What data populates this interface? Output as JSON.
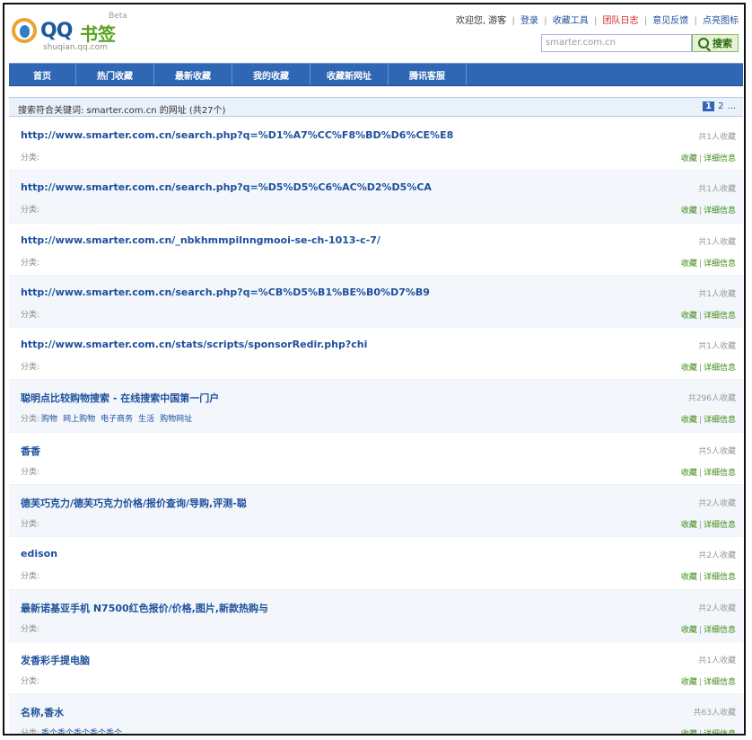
{
  "header": {
    "logo": {
      "qq": "QQ",
      "cn": "书签",
      "beta": "Beta",
      "sub": "shuqian.qq.com"
    },
    "welcome": "欢迎您, 游客",
    "links": [
      {
        "label": "登录",
        "red": false
      },
      {
        "label": "收藏工具",
        "red": false
      },
      {
        "label": "团队日志",
        "red": true
      },
      {
        "label": "意见反馈",
        "red": false
      },
      {
        "label": "点亮图标",
        "red": false
      }
    ],
    "search": {
      "value": "smarter.com.cn",
      "button": "搜索"
    }
  },
  "nav": [
    "首页",
    "热门收藏",
    "最新收藏",
    "我的收藏",
    "收藏新网址",
    "腾讯客服"
  ],
  "results": {
    "summary": "搜索符合关键词: smarter.com.cn 的网址 (共27个)",
    "pages": [
      "1",
      "2",
      "..."
    ]
  },
  "items": [
    {
      "title": "http://www.smarter.com.cn/search.php?q=%D1%A7%CC%F8%BD%D6%CE%E8",
      "count": "共1人收藏",
      "cat": "分类:",
      "tags": []
    },
    {
      "title": "http://www.smarter.com.cn/search.php?q=%D5%D5%C6%AC%D2%D5%CA",
      "count": "共1人收藏",
      "cat": "分类:",
      "tags": []
    },
    {
      "title": "http://www.smarter.com.cn/_nbkhmmpilnngmooi-se-ch-1013-c-7/",
      "count": "共1人收藏",
      "cat": "分类:",
      "tags": []
    },
    {
      "title": "http://www.smarter.com.cn/search.php?q=%CB%D5%B1%BE%B0%D7%B9",
      "count": "共1人收藏",
      "cat": "分类:",
      "tags": []
    },
    {
      "title": "http://www.smarter.com.cn/stats/scripts/sponsorRedir.php?chi",
      "count": "共1人收藏",
      "cat": "分类:",
      "tags": []
    },
    {
      "title": "聪明点比较购物搜索 - 在线搜索中国第一门户",
      "count": "共296人收藏",
      "cat": "分类:",
      "tags": [
        "购物",
        "网上购物",
        "电子商务",
        "生活",
        "购物网址"
      ]
    },
    {
      "title": "香香",
      "count": "共5人收藏",
      "cat": "分类:",
      "tags": []
    },
    {
      "title": "德芙巧克力/德芙巧克力价格/报价查询/导购,评测-聪",
      "count": "共2人收藏",
      "cat": "分类:",
      "tags": []
    },
    {
      "title": "edison",
      "count": "共2人收藏",
      "cat": "分类:",
      "tags": []
    },
    {
      "title": "最新诺基亚手机 N7500红色报价/价格,图片,新款热购与",
      "count": "共2人收藏",
      "cat": "分类:",
      "tags": []
    },
    {
      "title": "发香彩手提电脑",
      "count": "共1人收藏",
      "cat": "分类:",
      "tags": []
    },
    {
      "title": "名称,香水",
      "count": "共63人收藏",
      "cat": "分类:",
      "tags": [
        "香个香个香个香个香个"
      ]
    }
  ],
  "actions": {
    "fav": "收藏",
    "detail": "详细信息"
  }
}
